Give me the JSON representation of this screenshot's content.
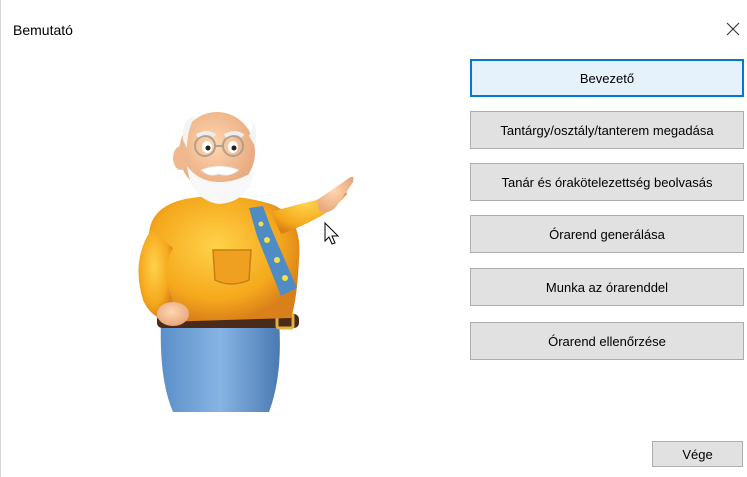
{
  "window": {
    "title": "Bemutató"
  },
  "menu": {
    "buttons": [
      {
        "label": "Bevezető",
        "focused": true
      },
      {
        "label": "Tantárgy/osztály/tanterem megadása",
        "focused": false
      },
      {
        "label": "Tanár és órakötelezettség beolvasás",
        "focused": false
      },
      {
        "label": "Órarend generálása",
        "focused": false
      },
      {
        "label": "Munka az órarenddel",
        "focused": false
      },
      {
        "label": "Órarend ellenőrzése",
        "focused": false
      }
    ]
  },
  "footer": {
    "exit_label": "Vége"
  },
  "icons": {
    "close": "close-icon",
    "mascot": "teacher-mascot-illustration",
    "cursor": "mouse-pointer-icon"
  },
  "colors": {
    "button_bg": "#e1e1e1",
    "button_border": "#adadad",
    "focus_border": "#0078d7",
    "focus_bg": "#e5f1fb"
  }
}
